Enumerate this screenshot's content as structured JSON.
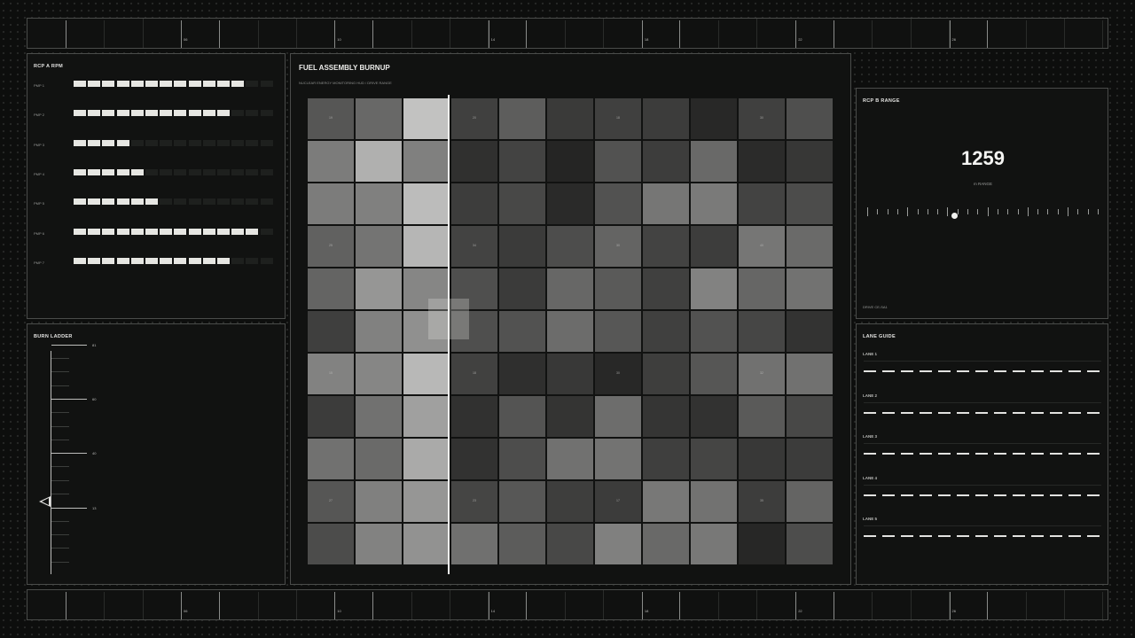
{
  "top_ruler": {
    "labels": [
      "06",
      "10",
      "14",
      "18",
      "22",
      "26"
    ]
  },
  "bottom_ruler": {
    "labels": [
      "06",
      "10",
      "14",
      "18",
      "22",
      "26"
    ]
  },
  "rpm_panel": {
    "title": "RCP A  RPM",
    "pumps": [
      {
        "label": "PMP 1",
        "lit": 12,
        "total": 14
      },
      {
        "label": "PMP 2",
        "lit": 11,
        "total": 14
      },
      {
        "label": "PMP 3",
        "lit": 4,
        "total": 14
      },
      {
        "label": "PMP 4",
        "lit": 5,
        "total": 14
      },
      {
        "label": "PMP 5",
        "lit": 6,
        "total": 14
      },
      {
        "label": "PMP 6",
        "lit": 13,
        "total": 14
      },
      {
        "label": "PMP 7",
        "lit": 11,
        "total": 14
      }
    ]
  },
  "burn_ladder": {
    "title": "BURN LADDER",
    "marks": [
      "81",
      "60",
      "40",
      "13"
    ],
    "pointer_value": 13
  },
  "fuel_map": {
    "title": "FUEL ASSEMBLY BURNUP",
    "subtitle": "NUCLEAR ENERGY MONITORING HUD  /  DRIVE RANGE",
    "rows": 11,
    "cols": 11,
    "cells": [
      [
        86,
        104,
        194,
        64,
        93,
        58,
        64,
        60,
        40,
        64,
        79
      ],
      [
        124,
        176,
        128,
        48,
        67,
        37,
        82,
        61,
        105,
        43,
        55
      ],
      [
        124,
        128,
        188,
        61,
        72,
        42,
        82,
        118,
        122,
        67,
        76
      ],
      [
        97,
        116,
        182,
        67,
        59,
        77,
        100,
        67,
        61,
        118,
        106
      ],
      [
        100,
        150,
        134,
        79,
        59,
        103,
        90,
        64,
        130,
        102,
        114
      ],
      [
        63,
        129,
        144,
        79,
        82,
        108,
        87,
        64,
        82,
        70,
        51
      ],
      [
        130,
        134,
        184,
        65,
        47,
        56,
        40,
        62,
        86,
        113,
        113
      ],
      [
        60,
        113,
        160,
        49,
        84,
        52,
        109,
        53,
        50,
        90,
        72
      ],
      [
        113,
        106,
        170,
        50,
        77,
        113,
        115,
        63,
        69,
        56,
        60
      ],
      [
        86,
        128,
        150,
        69,
        87,
        62,
        60,
        120,
        114,
        61,
        100
      ],
      [
        76,
        130,
        146,
        112,
        92,
        72,
        128,
        105,
        120,
        39,
        77
      ]
    ],
    "cell_labels": [
      {
        "row": 0,
        "col": 0,
        "text": "19"
      },
      {
        "row": 0,
        "col": 3,
        "text": "20"
      },
      {
        "row": 0,
        "col": 6,
        "text": "18"
      },
      {
        "row": 0,
        "col": 9,
        "text": "30"
      },
      {
        "row": 3,
        "col": 0,
        "text": "25"
      },
      {
        "row": 3,
        "col": 3,
        "text": "34"
      },
      {
        "row": 3,
        "col": 6,
        "text": "30"
      },
      {
        "row": 3,
        "col": 9,
        "text": "40"
      },
      {
        "row": 6,
        "col": 0,
        "text": "15"
      },
      {
        "row": 6,
        "col": 3,
        "text": "18"
      },
      {
        "row": 6,
        "col": 6,
        "text": "30"
      },
      {
        "row": 6,
        "col": 9,
        "text": "32"
      },
      {
        "row": 9,
        "col": 0,
        "text": "27"
      },
      {
        "row": 9,
        "col": 3,
        "text": "23"
      },
      {
        "row": 9,
        "col": 6,
        "text": "17"
      },
      {
        "row": 9,
        "col": 9,
        "text": "35"
      }
    ],
    "cursor_col": 3
  },
  "rcp_b": {
    "title": "RCP B  RANGE",
    "value": "1259",
    "unit_label": "m  RANGE",
    "scale_fraction": 0.38,
    "footer": "DRIVE CE-SA1"
  },
  "lane_guide": {
    "title": "LANE GUIDE",
    "lanes": [
      "LANE 1",
      "LANE 2",
      "LANE 3",
      "LANE 4",
      "LANE 5"
    ]
  }
}
